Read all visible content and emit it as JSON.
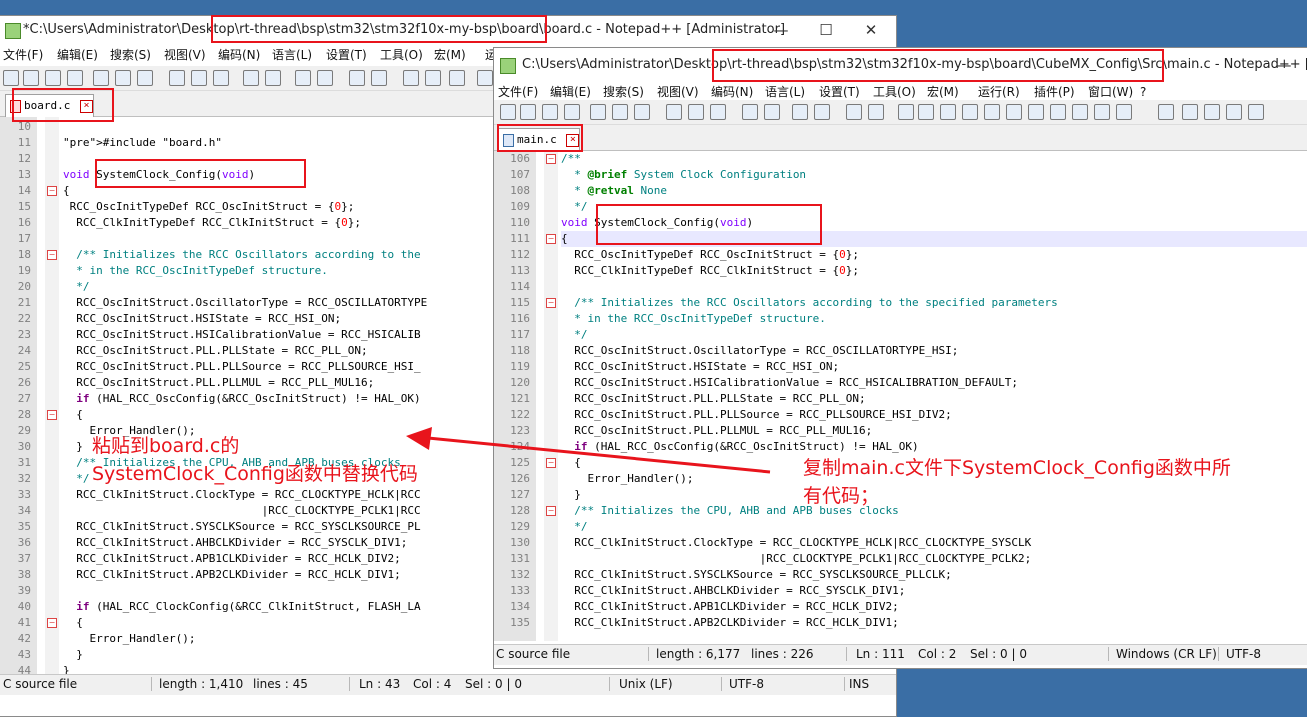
{
  "desktop": {
    "bg_color": "#3a6ea5"
  },
  "back_window": {
    "title": "*C:\\Users\\Administrator\\Desktop\\rt-thread\\bsp\\stm32\\stm32f10x-my-bsp\\board\\board.c - Notepad++ [Administrator]",
    "menus": [
      "文件(F)",
      "编辑(E)",
      "搜索(S)",
      "视图(V)",
      "编码(N)",
      "语言(L)",
      "设置(T)",
      "工具(O)",
      "宏(M)",
      "运"
    ],
    "tab_label": "board.c",
    "first_line": 10,
    "lines": [
      "",
      "#include \"board.h\"",
      "",
      "void SystemClock_Config(void)",
      "{",
      " RCC_OscInitTypeDef RCC_OscInitStruct = {0};",
      "  RCC_ClkInitTypeDef RCC_ClkInitStruct = {0};",
      "",
      "  /** Initializes the RCC Oscillators according to the",
      "  * in the RCC_OscInitTypeDef structure.",
      "  */",
      "  RCC_OscInitStruct.OscillatorType = RCC_OSCILLATORTYPE",
      "  RCC_OscInitStruct.HSIState = RCC_HSI_ON;",
      "  RCC_OscInitStruct.HSICalibrationValue = RCC_HSICALIB",
      "  RCC_OscInitStruct.PLL.PLLState = RCC_PLL_ON;",
      "  RCC_OscInitStruct.PLL.PLLSource = RCC_PLLSOURCE_HSI_",
      "  RCC_OscInitStruct.PLL.PLLMUL = RCC_PLL_MUL16;",
      "  if (HAL_RCC_OscConfig(&RCC_OscInitStruct) != HAL_OK)",
      "  {",
      "    Error_Handler();",
      "  }",
      "  /** Initializes the CPU, AHB and APB buses clocks",
      "  */",
      "  RCC_ClkInitStruct.ClockType = RCC_CLOCKTYPE_HCLK|RCC",
      "                              |RCC_CLOCKTYPE_PCLK1|RCC",
      "  RCC_ClkInitStruct.SYSCLKSource = RCC_SYSCLKSOURCE_PL",
      "  RCC_ClkInitStruct.AHBCLKDivider = RCC_SYSCLK_DIV1;",
      "  RCC_ClkInitStruct.APB1CLKDivider = RCC_HCLK_DIV2;",
      "  RCC_ClkInitStruct.APB2CLKDivider = RCC_HCLK_DIV1;",
      "",
      "  if (HAL_RCC_ClockConfig(&RCC_ClkInitStruct, FLASH_LA",
      "  {",
      "    Error_Handler();",
      "  }",
      "}"
    ],
    "status": {
      "type": "C source file",
      "length": "length : 1,410",
      "lines": "lines : 45",
      "ln": "Ln : 43",
      "col": "Col : 4",
      "sel": "Sel : 0 | 0",
      "eol": "Unix (LF)",
      "encoding": "UTF-8",
      "mode": "INS"
    }
  },
  "front_window": {
    "title": "C:\\Users\\Administrator\\Desktop\\rt-thread\\bsp\\stm32\\stm32f10x-my-bsp\\board\\CubeMX_Config\\Src\\main.c - Notepad++ [...",
    "menus": [
      "文件(F)",
      "编辑(E)",
      "搜索(S)",
      "视图(V)",
      "编码(N)",
      "语言(L)",
      "设置(T)",
      "工具(O)",
      "宏(M)",
      "运行(R)",
      "插件(P)",
      "窗口(W)",
      "?"
    ],
    "tab_label": "main.c",
    "first_line": 106,
    "lines": [
      "/**",
      "  * @brief System Clock Configuration",
      "  * @retval None",
      "  */",
      "void SystemClock_Config(void)",
      "{",
      "  RCC_OscInitTypeDef RCC_OscInitStruct = {0};",
      "  RCC_ClkInitTypeDef RCC_ClkInitStruct = {0};",
      "",
      "  /** Initializes the RCC Oscillators according to the specified parameters",
      "  * in the RCC_OscInitTypeDef structure.",
      "  */",
      "  RCC_OscInitStruct.OscillatorType = RCC_OSCILLATORTYPE_HSI;",
      "  RCC_OscInitStruct.HSIState = RCC_HSI_ON;",
      "  RCC_OscInitStruct.HSICalibrationValue = RCC_HSICALIBRATION_DEFAULT;",
      "  RCC_OscInitStruct.PLL.PLLState = RCC_PLL_ON;",
      "  RCC_OscInitStruct.PLL.PLLSource = RCC_PLLSOURCE_HSI_DIV2;",
      "  RCC_OscInitStruct.PLL.PLLMUL = RCC_PLL_MUL16;",
      "  if (HAL_RCC_OscConfig(&RCC_OscInitStruct) != HAL_OK)",
      "  {",
      "    Error_Handler();",
      "  }",
      "  /** Initializes the CPU, AHB and APB buses clocks",
      "  */",
      "  RCC_ClkInitStruct.ClockType = RCC_CLOCKTYPE_HCLK|RCC_CLOCKTYPE_SYSCLK",
      "                              |RCC_CLOCKTYPE_PCLK1|RCC_CLOCKTYPE_PCLK2;",
      "  RCC_ClkInitStruct.SYSCLKSource = RCC_SYSCLKSOURCE_PLLCLK;",
      "  RCC_ClkInitStruct.AHBCLKDivider = RCC_SYSCLK_DIV1;",
      "  RCC_ClkInitStruct.APB1CLKDivider = RCC_HCLK_DIV2;",
      "  RCC_ClkInitStruct.APB2CLKDivider = RCC_HCLK_DIV1;"
    ],
    "status": {
      "type": "C source file",
      "length": "length : 6,177",
      "lines": "lines : 226",
      "ln": "Ln : 111",
      "col": "Col : 2",
      "sel": "Sel : 0 | 0",
      "eol": "Windows (CR LF)",
      "encoding": "UTF-8"
    }
  },
  "annotations": {
    "paste_line1": "粘贴到board.c的",
    "paste_line2": "SystemClock_Config函数中替换代码",
    "copy_line1": "复制main.c文件下SystemClock_Config函数中所",
    "copy_line2": "有代码；",
    "color": "#e8141c"
  }
}
